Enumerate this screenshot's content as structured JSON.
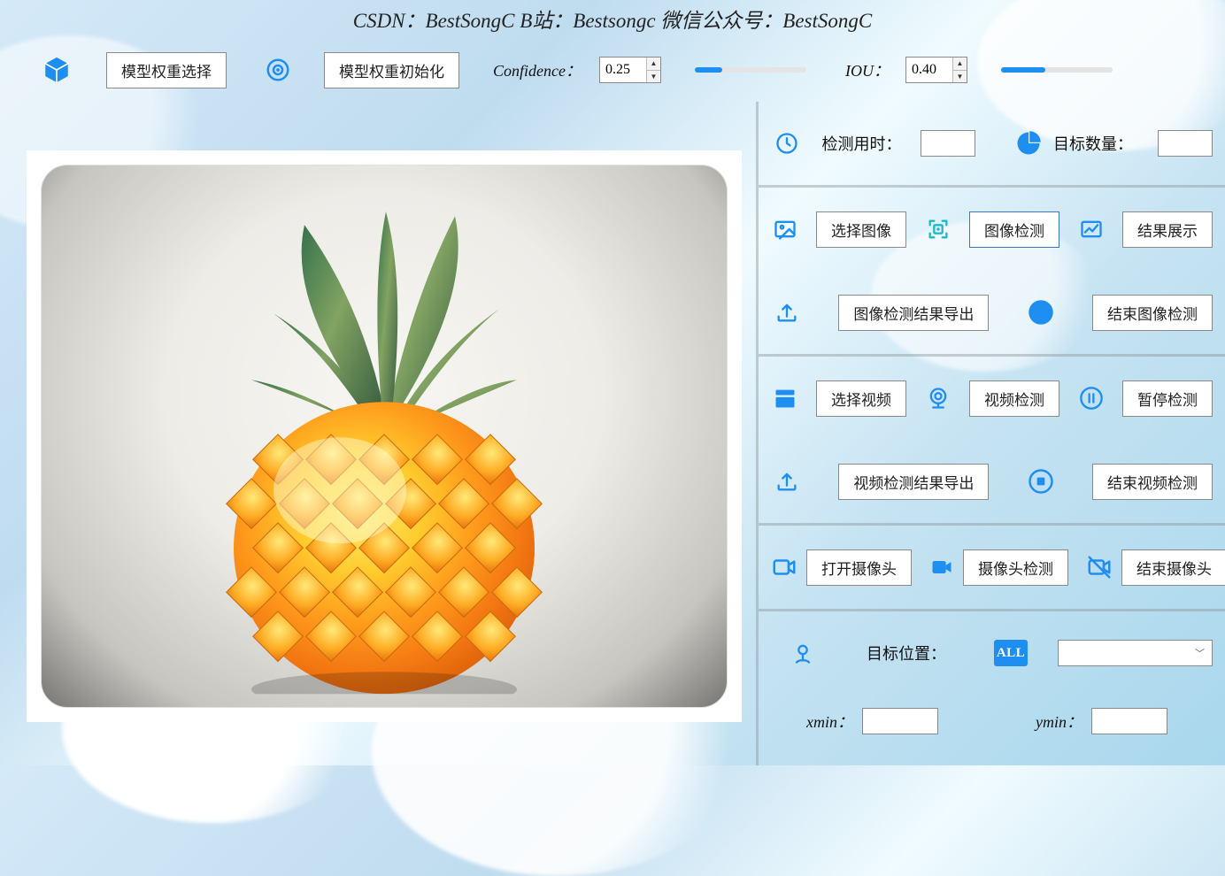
{
  "header": {
    "text": "CSDN：BestSongC    B站：Bestsongc    微信公众号：BestSongC"
  },
  "toolbar": {
    "model_select": "模型权重选择",
    "model_init": "模型权重初始化",
    "confidence_label": "Confidence：",
    "confidence_value": "0.25",
    "iou_label": "IOU：",
    "iou_value": "0.40"
  },
  "stats": {
    "time_label": "检测用时：",
    "time_value": "",
    "count_label": "目标数量：",
    "count_value": ""
  },
  "image_controls": {
    "select_image": "选择图像",
    "detect_image": "图像检测",
    "show_results": "结果展示",
    "export_results": "图像检测结果导出",
    "end_detect": "结束图像检测"
  },
  "video_controls": {
    "select_video": "选择视频",
    "detect_video": "视频检测",
    "pause_detect": "暂停检测",
    "export_results": "视频检测结果导出",
    "end_detect": "结束视频检测"
  },
  "camera_controls": {
    "open_camera": "打开摄像头",
    "detect_camera": "摄像头检测",
    "close_camera": "结束摄像头"
  },
  "target_position": {
    "label": "目标位置：",
    "badge": "ALL",
    "xmin_label": "xmin：",
    "xmin_value": "",
    "ymin_label": "ymin：",
    "ymin_value": ""
  }
}
